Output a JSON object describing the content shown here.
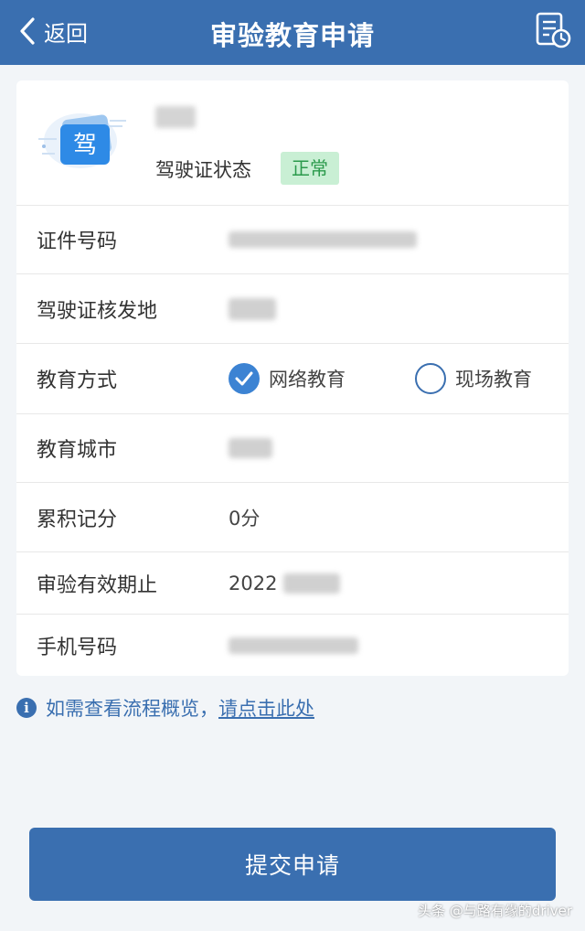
{
  "header": {
    "back_label": "返回",
    "title": "审验教育申请",
    "background": "#3a6fb0"
  },
  "profile": {
    "icon_char": "驾",
    "status_label": "驾驶证状态",
    "status_value": "正常"
  },
  "fields": {
    "id_number": {
      "label": "证件号码"
    },
    "issue_place": {
      "label": "驾驶证核发地"
    },
    "education_method": {
      "label": "教育方式",
      "options": [
        {
          "label": "网络教育",
          "selected": true
        },
        {
          "label": "现场教育",
          "selected": false
        }
      ]
    },
    "education_city": {
      "label": "教育城市"
    },
    "points": {
      "label": "累积记分",
      "value": "0分"
    },
    "valid_until": {
      "label": "审验有效期止",
      "value_visible": "2022"
    },
    "phone": {
      "label": "手机号码"
    }
  },
  "tip": {
    "text": "如需查看流程概览，",
    "link": "请点击此处"
  },
  "submit_label": "提交申请",
  "watermark": "头条 @与路有缘的driver",
  "colors": {
    "primary": "#3a6fb0",
    "check": "#3c83d3",
    "status_green": "#2a9a4b",
    "status_bg": "#c9efd4"
  }
}
